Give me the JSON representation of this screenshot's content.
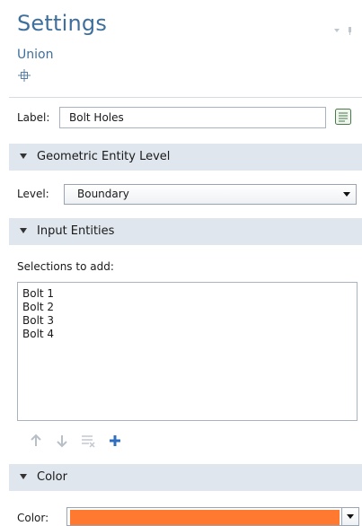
{
  "header": {
    "title": "Settings",
    "subtitle": "Union",
    "move_icon": "move-crosshair-icon",
    "controls": [
      "dropdown-arrow-icon",
      "pin-icon"
    ]
  },
  "label_row": {
    "label": "Label:",
    "value": "Bolt Holes",
    "button_icon": "edit-label-icon"
  },
  "sections": {
    "geometric": "Geometric Entity Level",
    "input": "Input Entities",
    "color": "Color"
  },
  "level_row": {
    "label": "Level:",
    "selected": "Boundary"
  },
  "selections": {
    "caption": "Selections to add:",
    "items": [
      "Bolt 1",
      "Bolt 2",
      "Bolt 3",
      "Bolt 4"
    ],
    "toolbar": [
      "move-up-icon",
      "move-down-icon",
      "delete-icon",
      "add-icon"
    ]
  },
  "color_row": {
    "label": "Color:",
    "swatch": "#ff7a30"
  },
  "colors": {
    "accent": "#3f6f9c",
    "section_bg": "#dfe6ee",
    "add_icon": "#2f6fbf"
  }
}
